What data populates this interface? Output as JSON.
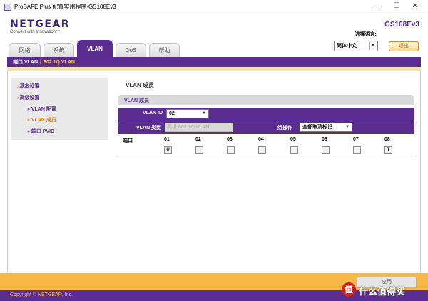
{
  "window": {
    "title": "ProSAFE Plus 配置实用程序-GS108Ev3"
  },
  "header": {
    "logo": "NETGEAR",
    "tagline": "Connect with Innovation™",
    "model": "GS108Ev3",
    "language_label": "选择语言:",
    "language_value": "简体中文",
    "logout_label": "退出"
  },
  "tabs": [
    {
      "label": "网络"
    },
    {
      "label": "系统"
    },
    {
      "label": "VLAN"
    },
    {
      "label": "QoS"
    },
    {
      "label": "帮助"
    }
  ],
  "breadcrumb": {
    "section": "端口 VLAN",
    "current": "802.1Q VLAN"
  },
  "sidebar": {
    "items": [
      {
        "label": "基本设置"
      },
      {
        "label": "高级设置"
      },
      {
        "label": "» VLAN 配置"
      },
      {
        "label": "» VLAN 成员"
      },
      {
        "label": "» 端口 PVID"
      }
    ]
  },
  "main": {
    "title": "VLAN 成员",
    "section_title": "VLAN 成员",
    "vlan_id_label": "VLAN ID",
    "vlan_id_value": "02",
    "vlan_type_label": "VLAN 类型",
    "vlan_type_value": "高级 802.1Q VLAN",
    "group_op_label": "组操作",
    "group_op_value": "全部取消标记",
    "port_header": "端口",
    "ports": [
      {
        "num": "01",
        "value": "U"
      },
      {
        "num": "02",
        "value": ""
      },
      {
        "num": "03",
        "value": ""
      },
      {
        "num": "04",
        "value": ""
      },
      {
        "num": "05",
        "value": ""
      },
      {
        "num": "06",
        "value": ""
      },
      {
        "num": "07",
        "value": ""
      },
      {
        "num": "08",
        "value": "T"
      }
    ]
  },
  "footer": {
    "copyright": "Copyright © NETGEAR, Inc.",
    "button_label": "应用",
    "watermark": "什么值得买"
  }
}
